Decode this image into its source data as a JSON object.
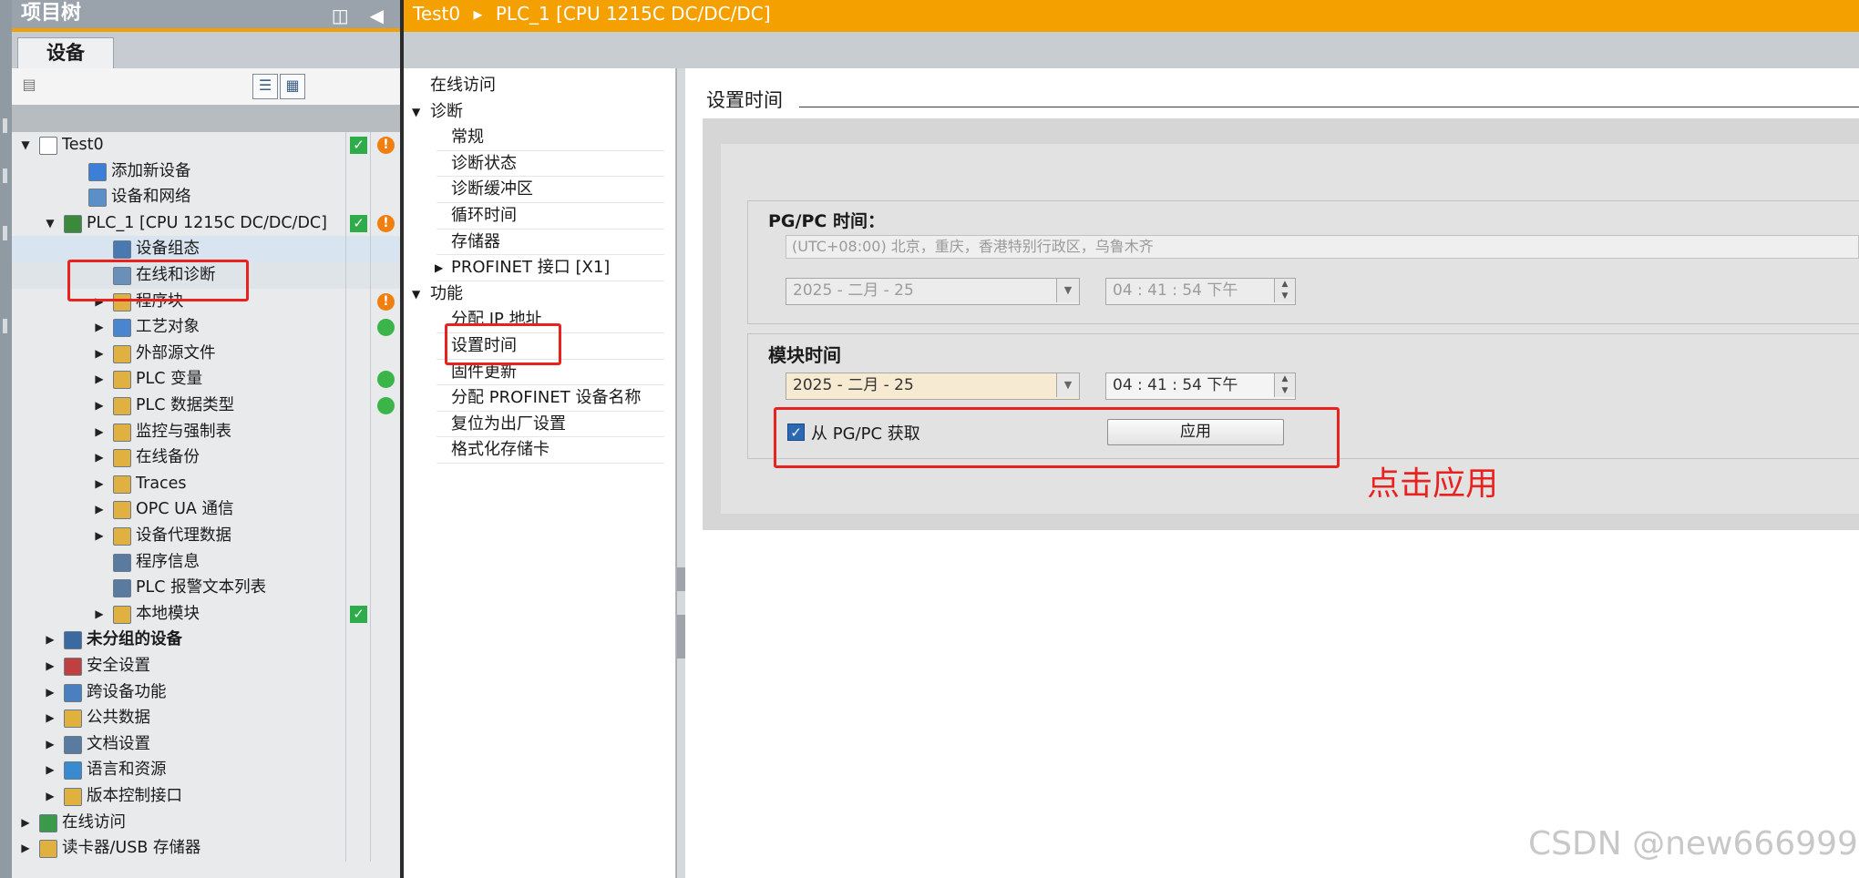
{
  "tree_panel": {
    "title": "项目树",
    "header_icons": "◫ ◀",
    "devices_tab": "设备",
    "rows": [
      {
        "label": "Test0",
        "indent": 0,
        "arrow": "▼",
        "status1": "check",
        "status2": "warn",
        "icon_color": "#ffffff"
      },
      {
        "label": "添加新设备",
        "indent": 2,
        "arrow": "",
        "icon_color": "#3d7fd6"
      },
      {
        "label": "设备和网络",
        "indent": 2,
        "arrow": "",
        "icon_color": "#5a8fc8"
      },
      {
        "label": "PLC_1 [CPU 1215C DC/DC/DC]",
        "indent": 1,
        "arrow": "▼",
        "status1": "check",
        "status2": "warn",
        "icon_color": "#3a8a3a"
      },
      {
        "label": "设备组态",
        "indent": 3,
        "arrow": "",
        "icon_color": "#4a78b0",
        "selected": true
      },
      {
        "label": "在线和诊断",
        "indent": 3,
        "arrow": "",
        "icon_color": "#6a8fb8",
        "hover": true
      },
      {
        "label": "程序块",
        "indent": 3,
        "arrow": "▶",
        "status2": "warn",
        "icon_color": "#e0b040"
      },
      {
        "label": "工艺对象",
        "indent": 3,
        "arrow": "▶",
        "status2": "ok",
        "icon_color": "#4a86d0"
      },
      {
        "label": "外部源文件",
        "indent": 3,
        "arrow": "▶",
        "icon_color": "#e0b040"
      },
      {
        "label": "PLC 变量",
        "indent": 3,
        "arrow": "▶",
        "status2": "ok",
        "icon_color": "#e0b040"
      },
      {
        "label": "PLC 数据类型",
        "indent": 3,
        "arrow": "▶",
        "status2": "ok",
        "icon_color": "#e0b040"
      },
      {
        "label": "监控与强制表",
        "indent": 3,
        "arrow": "▶",
        "icon_color": "#e0b040"
      },
      {
        "label": "在线备份",
        "indent": 3,
        "arrow": "▶",
        "icon_color": "#e0b040"
      },
      {
        "label": "Traces",
        "indent": 3,
        "arrow": "▶",
        "icon_color": "#e0b040"
      },
      {
        "label": "OPC UA 通信",
        "indent": 3,
        "arrow": "▶",
        "icon_color": "#e0b040"
      },
      {
        "label": "设备代理数据",
        "indent": 3,
        "arrow": "▶",
        "icon_color": "#e0b040"
      },
      {
        "label": "程序信息",
        "indent": 3,
        "arrow": "",
        "icon_color": "#5a7aa0"
      },
      {
        "label": "PLC 报警文本列表",
        "indent": 3,
        "arrow": "",
        "icon_color": "#5a7aa0"
      },
      {
        "label": "本地模块",
        "indent": 3,
        "arrow": "▶",
        "status1": "check",
        "icon_color": "#e0b040"
      },
      {
        "label": "未分组的设备",
        "indent": 1,
        "arrow": "▶",
        "bold": true,
        "icon_color": "#3a6aa0"
      },
      {
        "label": "安全设置",
        "indent": 1,
        "arrow": "▶",
        "icon_color": "#c04040"
      },
      {
        "label": "跨设备功能",
        "indent": 1,
        "arrow": "▶",
        "icon_color": "#4a7fc0"
      },
      {
        "label": "公共数据",
        "indent": 1,
        "arrow": "▶",
        "icon_color": "#e0b040"
      },
      {
        "label": "文档设置",
        "indent": 1,
        "arrow": "▶",
        "icon_color": "#5a7aa0"
      },
      {
        "label": "语言和资源",
        "indent": 1,
        "arrow": "▶",
        "icon_color": "#3a8ad0"
      },
      {
        "label": "版本控制接口",
        "indent": 1,
        "arrow": "▶",
        "icon_color": "#e0b040"
      },
      {
        "label": "在线访问",
        "indent": 0,
        "arrow": "▶",
        "icon_color": "#3a9a4a"
      },
      {
        "label": "读卡器/USB 存储器",
        "indent": 0,
        "arrow": "▶",
        "icon_color": "#e0b040"
      }
    ]
  },
  "editor": {
    "breadcrumb": [
      "Test0",
      "PLC_1 [CPU 1215C DC/DC/DC]"
    ],
    "breadcrumb_sep": "▸"
  },
  "nav": {
    "items": [
      {
        "label": "在线访问",
        "level": 0,
        "arrow": ""
      },
      {
        "label": "诊断",
        "level": 0,
        "arrow": "▼"
      },
      {
        "label": "常规",
        "level": 1,
        "arrow": ""
      },
      {
        "label": "诊断状态",
        "level": 1,
        "arrow": ""
      },
      {
        "label": "诊断缓冲区",
        "level": 1,
        "arrow": ""
      },
      {
        "label": "循环时间",
        "level": 1,
        "arrow": ""
      },
      {
        "label": "存储器",
        "level": 1,
        "arrow": ""
      },
      {
        "label": "PROFINET 接口 [X1]",
        "level": 1,
        "arrow": "▶"
      },
      {
        "label": "功能",
        "level": 0,
        "arrow": "▼"
      },
      {
        "label": "分配 IP 地址",
        "level": 1,
        "arrow": ""
      },
      {
        "label": "设置时间",
        "level": 1,
        "arrow": ""
      },
      {
        "label": "固件更新",
        "level": 1,
        "arrow": ""
      },
      {
        "label": "分配 PROFINET 设备名称",
        "level": 1,
        "arrow": ""
      },
      {
        "label": "复位为出厂设置",
        "level": 1,
        "arrow": ""
      },
      {
        "label": "格式化存储卡",
        "level": 1,
        "arrow": ""
      }
    ]
  },
  "content": {
    "section_title": "设置时间",
    "pgpc_title": "PG/PC 时间：",
    "timezone": "(UTC+08:00) 北京，重庆，香港特别行政区，乌鲁木齐",
    "pgpc_date": "2025 - 二月  - 25",
    "pgpc_time": "04 : 41 : 54    下午",
    "module_title": "模块时间",
    "module_date": "2025 - 二月  - 25",
    "module_time": "04 : 41 : 54    下午",
    "checkbox_label": "从 PG/PC 获取",
    "checkbox_checked": true,
    "apply_label": "应用"
  },
  "annotation": {
    "text": "点击应用",
    "color": "#e8231f"
  },
  "watermark": "CSDN @new666999"
}
